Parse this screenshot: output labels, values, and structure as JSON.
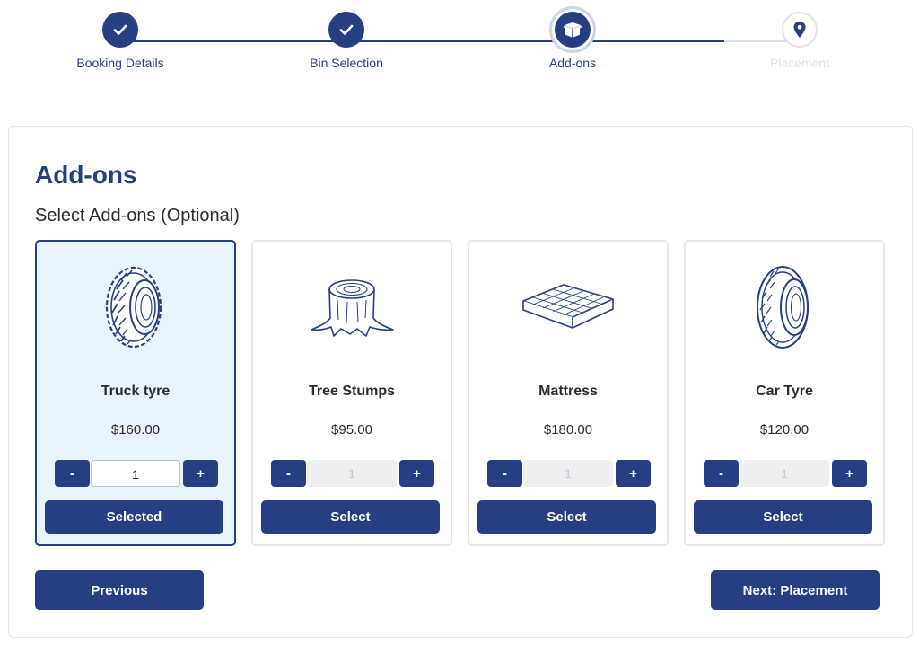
{
  "stepper": {
    "steps": [
      {
        "label": "Booking Details",
        "state": "done",
        "icon": "check-icon"
      },
      {
        "label": "Bin Selection",
        "state": "done",
        "icon": "check-icon"
      },
      {
        "label": "Add-ons",
        "state": "active",
        "icon": "box-icon"
      },
      {
        "label": "Placement",
        "state": "todo",
        "icon": "map-pin-icon"
      }
    ]
  },
  "page": {
    "title": "Add-ons",
    "subtitle": "Select Add-ons (Optional)"
  },
  "addons": [
    {
      "name": "Truck tyre",
      "price": "$160.00",
      "quantity": "1",
      "button": "Selected",
      "selected": true,
      "icon": "truck-tyre-icon"
    },
    {
      "name": "Tree Stumps",
      "price": "$95.00",
      "quantity": "1",
      "button": "Select",
      "selected": false,
      "icon": "tree-stump-icon"
    },
    {
      "name": "Mattress",
      "price": "$180.00",
      "quantity": "1",
      "button": "Select",
      "selected": false,
      "icon": "mattress-icon"
    },
    {
      "name": "Car Tyre",
      "price": "$120.00",
      "quantity": "1",
      "button": "Select",
      "selected": false,
      "icon": "car-tyre-icon"
    }
  ],
  "qty_controls": {
    "minus": "-",
    "plus": "+"
  },
  "nav": {
    "previous": "Previous",
    "next": "Next: Placement"
  },
  "colors": {
    "brand": "#263f82",
    "selected_card_bg": "#eaf4fe",
    "inactive_step": "#dde1e8"
  }
}
